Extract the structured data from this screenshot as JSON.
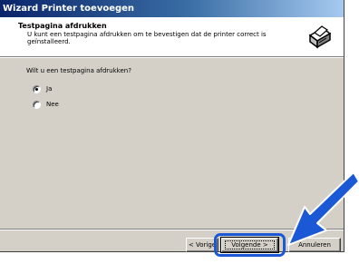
{
  "window": {
    "title": "Wizard Printer toevoegen"
  },
  "header": {
    "title": "Testpagina afdrukken",
    "subtitle": "U kunt een testpagina afdrukken om te bevestigen dat de printer correct is geïnstalleerd.",
    "icon": "printer-icon"
  },
  "body": {
    "question": "Wilt u een testpagina afdrukken?",
    "options": [
      {
        "label": "Ja",
        "selected": true
      },
      {
        "label": "Nee",
        "selected": false
      }
    ]
  },
  "buttons": {
    "back_label": "< Vorige",
    "next_label": "Volgende >",
    "cancel_label": "Annuleren"
  },
  "annotation": {
    "highlight_color": "#1a58d6",
    "arrow_color": "#1a58d6",
    "target": "next-button"
  },
  "colors": {
    "title_bar_start": "#0a246a",
    "title_bar_end": "#a6caf0",
    "dialog_face": "#d4d0c8"
  }
}
